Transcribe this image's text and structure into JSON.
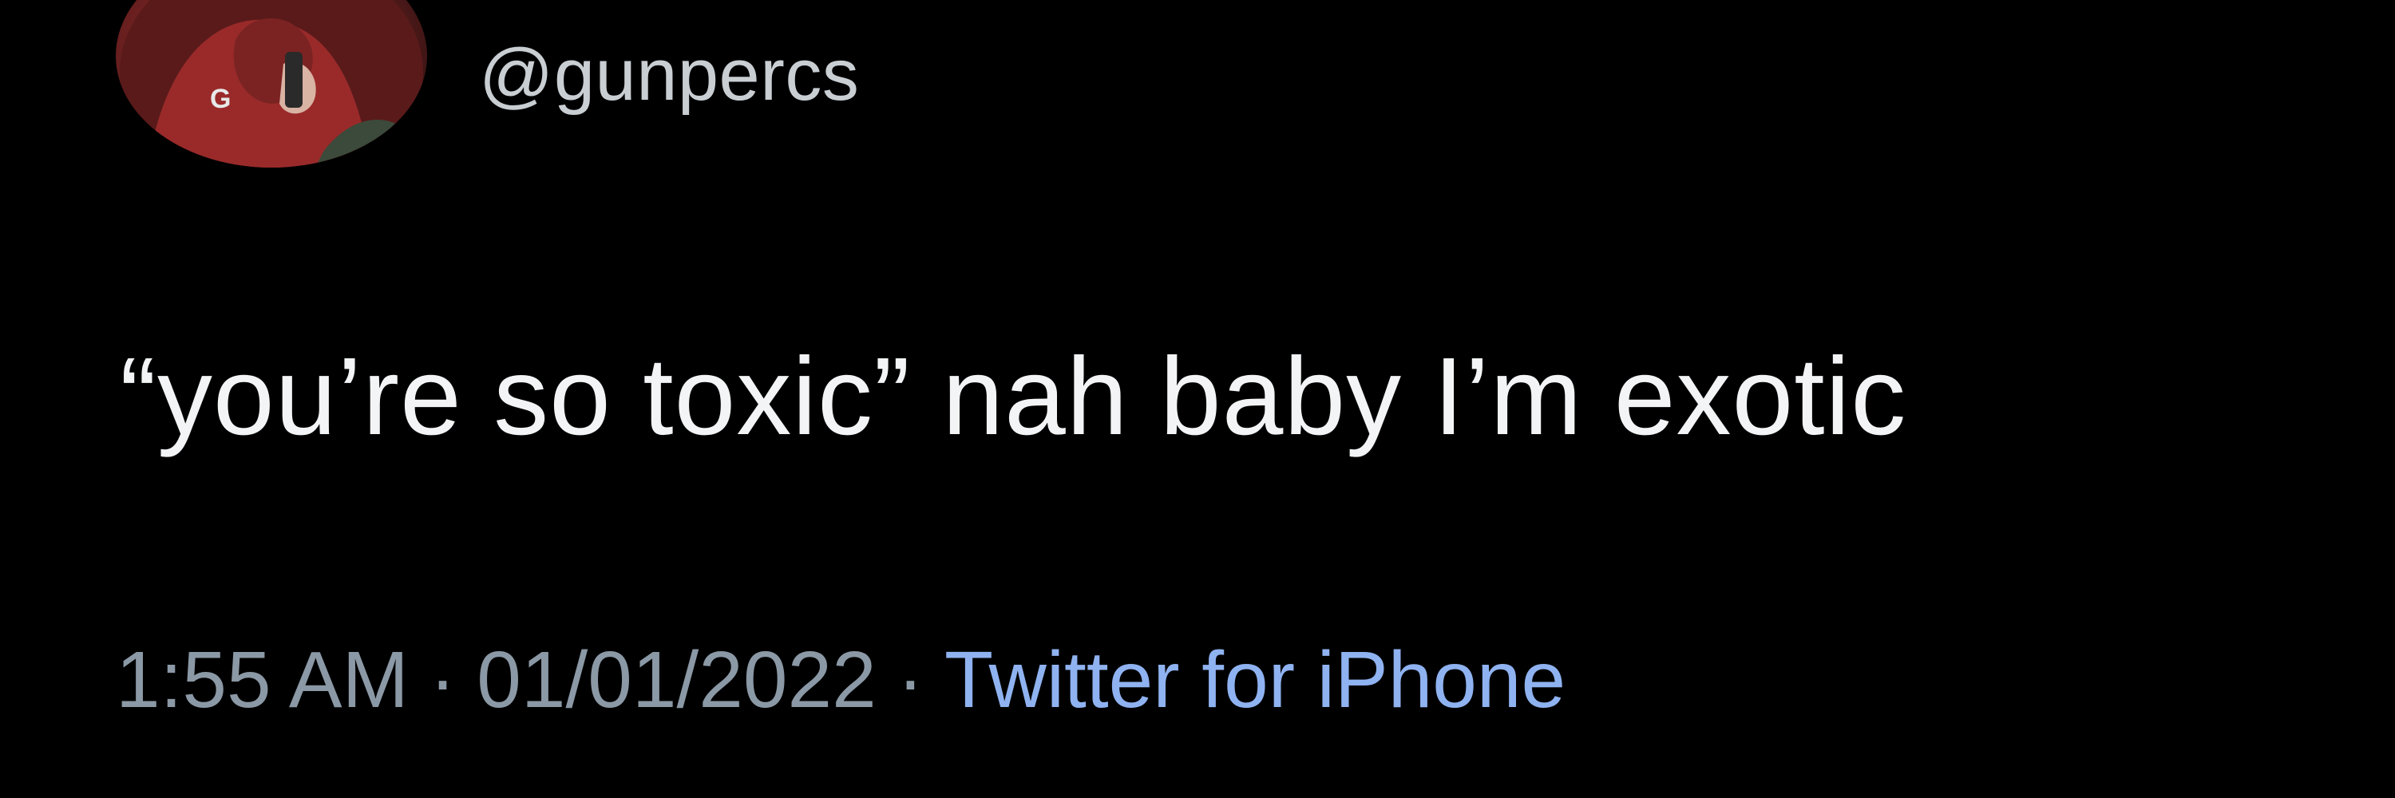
{
  "tweet": {
    "handle": "@gunpercs",
    "text": "“you’re so toxic” nah baby I’m exotic",
    "time": "1:55 AM",
    "date": "01/01/2022",
    "separator": "·",
    "source": "Twitter for iPhone"
  },
  "colors": {
    "background": "#000000",
    "text": "#f2f4f5",
    "muted": "#8b98a5",
    "link": "#8fb2f0"
  }
}
